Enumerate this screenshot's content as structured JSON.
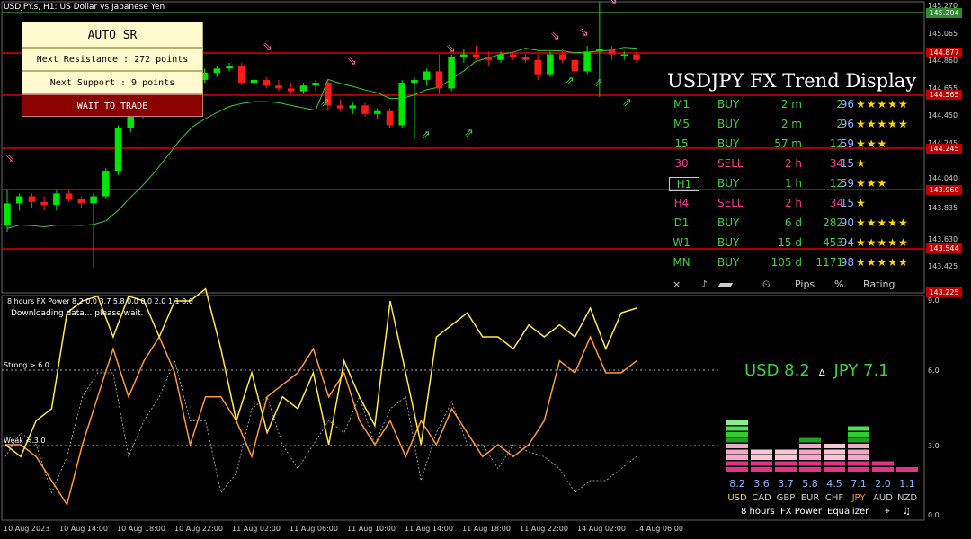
{
  "header": {
    "symbol_title": "USDJPY.s, H1:  US Dollar vs Japanese Yen"
  },
  "sr_panel": {
    "auto_label": "AUTO  SR",
    "resistance_label": "Next Resistance : 272 points",
    "support_label": "Next Support : 9 points",
    "action_label": "WAIT TO TRADE"
  },
  "trend_display": {
    "title": "USDJPY FX Trend Display",
    "rows": [
      {
        "tf": "M1",
        "signal": "BUY",
        "duration": "2 m",
        "pips": "2",
        "pct": "96",
        "stars": "★★★★★",
        "color": "#3cd13c"
      },
      {
        "tf": "M5",
        "signal": "BUY",
        "duration": "2 m",
        "pips": "2",
        "pct": "96",
        "stars": "★★★★★",
        "color": "#3cd13c"
      },
      {
        "tf": "15",
        "signal": "BUY",
        "duration": "57 m",
        "pips": "12",
        "pct": "59",
        "stars": "★★★",
        "color": "#3cd13c"
      },
      {
        "tf": "30",
        "signal": "SELL",
        "duration": "2 h",
        "pips": "34",
        "pct": "15",
        "stars": "★",
        "color": "#ff3399"
      },
      {
        "tf": "H1",
        "signal": "BUY",
        "duration": "1 h",
        "pips": "12",
        "pct": "59",
        "stars": "★★★",
        "color": "#3cd13c"
      },
      {
        "tf": "H4",
        "signal": "SELL",
        "duration": "2 h",
        "pips": "34",
        "pct": "15",
        "stars": "★",
        "color": "#ff3399"
      },
      {
        "tf": "D1",
        "signal": "BUY",
        "duration": "6 d",
        "pips": "282",
        "pct": "90",
        "stars": "★★★★★",
        "color": "#3cd13c"
      },
      {
        "tf": "W1",
        "signal": "BUY",
        "duration": "15 d",
        "pips": "453",
        "pct": "94",
        "stars": "★★★★★",
        "color": "#3cd13c"
      },
      {
        "tf": "MN",
        "signal": "BUY",
        "duration": "105 d",
        "pips": "1171",
        "pct": "98",
        "stars": "★★★★★",
        "color": "#3cd13c"
      }
    ],
    "footer": {
      "close": "×",
      "sound": "♪",
      "clock": "⏲",
      "pips": "Pips",
      "pct": "%",
      "rating": "Rating"
    }
  },
  "price_axis": [
    "145.270",
    "145.065",
    "144.860",
    "144.655",
    "144.450",
    "144.245",
    "144.040",
    "143.835",
    "143.630",
    "143.425",
    "143.220"
  ],
  "price_tags": [
    {
      "text": "145.204",
      "kind": "green"
    },
    {
      "text": "144.877",
      "kind": "red"
    },
    {
      "text": "144.565",
      "kind": "red"
    },
    {
      "text": "144.245",
      "kind": "red"
    },
    {
      "text": "143.960",
      "kind": "red"
    },
    {
      "text": "143.544",
      "kind": "red"
    },
    {
      "text": "143.225",
      "kind": "red"
    }
  ],
  "lower": {
    "title": "8 hours FX Power 8.2 0.0 3.7 5.8 0.0 0.0 2.0 1.1 0.0",
    "status": "Downloading data... please wait.",
    "strong_label": "Strong > 6.0",
    "weak_label": "Weak < 3.0",
    "axis": [
      "9.0",
      "6.0",
      "3.0",
      "0.0"
    ],
    "pair": {
      "base": "USD 8.2",
      "sep": "∆",
      "quote": "JPY 7.1"
    }
  },
  "equalizer": {
    "values": [
      "8.2",
      "3.6",
      "3.7",
      "5.8",
      "4.5",
      "7.1",
      "2.0",
      "1.1"
    ],
    "names": [
      "USD",
      "CAD",
      "GBP",
      "EUR",
      "CHF",
      "JPY",
      "AUD",
      "NZD"
    ],
    "name_colors": [
      "#ffd24d",
      "#cccccc",
      "#cccccc",
      "#cccccc",
      "#cccccc",
      "#ff9933",
      "#cccccc",
      "#cccccc"
    ],
    "footer": {
      "hours": "8 hours",
      "power": "FX Power",
      "equalizer": "Equalizer",
      "target": "⌖",
      "note": "♫"
    }
  },
  "time_axis": [
    "10 Aug 2023",
    "10 Aug 14:00",
    "10 Aug 18:00",
    "10 Aug 22:00",
    "11 Aug 02:00",
    "11 Aug 06:00",
    "11 Aug 10:00",
    "11 Aug 14:00",
    "11 Aug 18:00",
    "11 Aug 22:00",
    "14 Aug 02:00",
    "14 Aug 06:00"
  ],
  "colors": {
    "bull": "#00e600",
    "bear": "#ff1a1a",
    "sr_line": "#e00000",
    "ma": "#33cc33",
    "usd": "#ffea4d",
    "jpy": "#ff9933"
  },
  "chart_data": {
    "type": "candlestick",
    "x": [
      "10 Aug 2023",
      "10 Aug 14:00",
      "10 Aug 18:00",
      "10 Aug 22:00",
      "11 Aug 02:00",
      "11 Aug 06:00",
      "11 Aug 10:00",
      "11 Aug 14:00",
      "11 Aug 18:00",
      "11 Aug 22:00",
      "14 Aug 02:00",
      "14 Aug 06:00"
    ],
    "ylim": [
      143.22,
      145.27
    ],
    "levels": [
      145.204,
      144.877,
      144.565,
      144.245,
      143.96,
      143.544
    ],
    "candles": [
      [
        143.7,
        143.95,
        143.65,
        143.85
      ],
      [
        143.85,
        143.92,
        143.8,
        143.9
      ],
      [
        143.9,
        143.92,
        143.82,
        143.86
      ],
      [
        143.86,
        143.9,
        143.8,
        143.84
      ],
      [
        143.84,
        143.95,
        143.8,
        143.92
      ],
      [
        143.92,
        143.94,
        143.86,
        143.88
      ],
      [
        143.88,
        143.9,
        143.82,
        143.85
      ],
      [
        143.85,
        143.92,
        143.4,
        143.9
      ],
      [
        143.9,
        144.1,
        143.88,
        144.08
      ],
      [
        144.08,
        144.4,
        144.05,
        144.38
      ],
      [
        144.38,
        144.5,
        144.35,
        144.48
      ],
      [
        144.48,
        144.55,
        144.45,
        144.52
      ],
      [
        144.52,
        144.58,
        144.5,
        144.56
      ],
      [
        144.56,
        144.65,
        144.55,
        144.62
      ],
      [
        144.62,
        144.7,
        144.6,
        144.68
      ],
      [
        144.68,
        144.75,
        144.66,
        144.72
      ],
      [
        144.72,
        144.8,
        144.7,
        144.77
      ],
      [
        144.77,
        144.82,
        144.74,
        144.8
      ],
      [
        144.8,
        144.84,
        144.78,
        144.82
      ],
      [
        144.82,
        144.84,
        144.68,
        144.7
      ],
      [
        144.7,
        144.74,
        144.66,
        144.72
      ],
      [
        144.72,
        144.74,
        144.66,
        144.68
      ],
      [
        144.68,
        144.72,
        144.64,
        144.66
      ],
      [
        144.66,
        144.7,
        144.62,
        144.64
      ],
      [
        144.64,
        144.7,
        144.62,
        144.68
      ],
      [
        144.68,
        144.72,
        144.64,
        144.7
      ],
      [
        144.7,
        144.72,
        144.5,
        144.54
      ],
      [
        144.54,
        144.58,
        144.5,
        144.52
      ],
      [
        144.52,
        144.56,
        144.48,
        144.54
      ],
      [
        144.54,
        144.56,
        144.46,
        144.48
      ],
      [
        144.48,
        144.52,
        144.44,
        144.5
      ],
      [
        144.5,
        144.52,
        144.38,
        144.4
      ],
      [
        144.4,
        144.72,
        144.38,
        144.7
      ],
      [
        144.7,
        144.74,
        144.3,
        144.72
      ],
      [
        144.72,
        144.8,
        144.68,
        144.78
      ],
      [
        144.78,
        144.9,
        144.62,
        144.66
      ],
      [
        144.66,
        144.9,
        144.64,
        144.88
      ],
      [
        144.88,
        144.94,
        144.84,
        144.9
      ],
      [
        144.9,
        144.96,
        144.86,
        144.88
      ],
      [
        144.88,
        144.92,
        144.82,
        144.86
      ],
      [
        144.86,
        144.92,
        144.84,
        144.9
      ],
      [
        144.9,
        144.92,
        144.86,
        144.88
      ],
      [
        144.88,
        144.9,
        144.84,
        144.86
      ],
      [
        144.86,
        144.9,
        144.72,
        144.76
      ],
      [
        144.76,
        144.92,
        144.74,
        144.9
      ],
      [
        144.9,
        144.94,
        144.84,
        144.86
      ],
      [
        144.86,
        144.88,
        144.74,
        144.78
      ],
      [
        144.78,
        144.96,
        144.76,
        144.92
      ],
      [
        144.92,
        145.27,
        144.6,
        144.94
      ],
      [
        144.94,
        144.96,
        144.86,
        144.9
      ],
      [
        144.9,
        144.92,
        144.86,
        144.9
      ],
      [
        144.9,
        144.92,
        144.84,
        144.86
      ]
    ]
  }
}
